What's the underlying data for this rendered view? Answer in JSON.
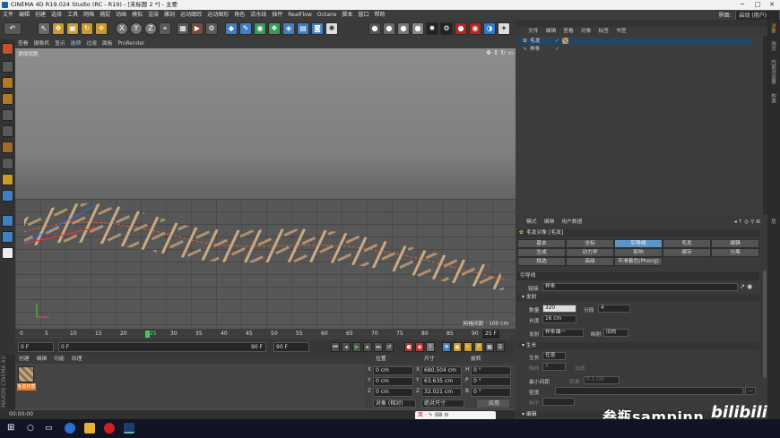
{
  "window": {
    "title": "CINEMA 4D R19.024 Studio (RC - R19) - [未标题 2 *] - 主要"
  },
  "menu": [
    "文件",
    "编辑",
    "创建",
    "选择",
    "工具",
    "网格",
    "捕捉",
    "动画",
    "模拟",
    "渲染",
    "雕刻",
    "运动跟踪",
    "运动图形",
    "角色",
    "流水线",
    "插件",
    "RealFlow",
    "Octane",
    "脚本",
    "窗口",
    "帮助"
  ],
  "layout": {
    "label": "界面:",
    "value": "启动 (用户)"
  },
  "toolbar_icons": [
    "undo-icon",
    "select-arrow-icon",
    "move-icon",
    "scale-icon",
    "rotate-icon",
    "add-icon",
    "x-axis-icon",
    "y-axis-icon",
    "z-axis-icon",
    "coord-icon",
    "render-region-icon",
    "render-view-icon",
    "render-settings-icon",
    "cube-icon",
    "pen-icon",
    "subdivision-icon",
    "cloner-icon",
    "deformer-icon",
    "scene-icon",
    "camera-icon",
    "light-icon"
  ],
  "toolbar_axis": [
    "X",
    "Y",
    "Z"
  ],
  "viewport_menu": [
    "查看",
    "摄像机",
    "显示",
    "选项",
    "过滤",
    "面板",
    "ProRender"
  ],
  "viewport": {
    "label": "透视视图",
    "grid_info": "网格间距 : 100 cm"
  },
  "timeline": {
    "ticks": [
      "0",
      "5",
      "10",
      "15",
      "20",
      "25",
      "30",
      "35",
      "40",
      "45",
      "50",
      "55",
      "60",
      "65",
      "70",
      "75",
      "80",
      "85",
      "90"
    ],
    "current": "25",
    "end_label": "25 F"
  },
  "transport": {
    "start": "0 F",
    "field2": "0 F",
    "field3": "90 F",
    "field4": "90 F"
  },
  "materials": {
    "menu": [
      "创建",
      "编辑",
      "功能",
      "纹理"
    ],
    "thumb_name": "毛发材质"
  },
  "maxon": "MAXON CINEMA 4D",
  "coords": {
    "headers": [
      "位置",
      "尺寸",
      "旋转"
    ],
    "rows": [
      {
        "axis": "X",
        "pos": "0 cm",
        "size_axis": "X",
        "size": "680.504 cm",
        "rot_axis": "H",
        "rot": "0 °"
      },
      {
        "axis": "Y",
        "pos": "0 cm",
        "size_axis": "Y",
        "size": "63.635 cm",
        "rot_axis": "P",
        "rot": "0 °"
      },
      {
        "axis": "Z",
        "pos": "0 cm",
        "size_axis": "Z",
        "size": "32.021 cm",
        "rot_axis": "B",
        "rot": "0 °"
      }
    ],
    "mode": "对象 (相对)",
    "size_mode": "绝对尺寸",
    "apply": "应用"
  },
  "status": {
    "time": "00:00:00"
  },
  "objects": {
    "menu": [
      "文件",
      "编辑",
      "查看",
      "对象",
      "标签",
      "书签"
    ],
    "rows": [
      {
        "name": "毛发",
        "selected": true
      },
      {
        "name": "样条",
        "selected": false
      }
    ]
  },
  "side_tabs": [
    "对象",
    "场次",
    "内容浏览器",
    "构造",
    "层"
  ],
  "attributes": {
    "menu": [
      "模式",
      "编辑",
      "用户数据"
    ],
    "object_title": "毛发对象 [毛发]",
    "tabs": [
      "基本",
      "坐标",
      "引导线",
      "毛发",
      "编辑",
      "生成",
      "动力学",
      "影响",
      "缓存",
      "分离",
      "挑选",
      "高级",
      "平滑着色(Phong)"
    ],
    "active_tab": "引导线",
    "section_title": "引导线",
    "link_label": "链接",
    "link_value": "样条",
    "group_emit": "发射",
    "count_label": "数量",
    "count_value": "320",
    "segments_label": "分段",
    "segments_value": "4",
    "length_label": "长度",
    "length_value": "16 cm",
    "emit_label": "发射",
    "emit_value": "样条端一",
    "map_label": "映射",
    "map_value": "旧的",
    "group_grow": "生长",
    "grow_label": "生长",
    "grow_value": "任意",
    "axis_label": "轴向",
    "axis_value": "X",
    "normal_label": "法线",
    "min_spacing_label": "最小间距",
    "distance_label": "距离",
    "distance_value": "0.1 cm",
    "density_label": "密度",
    "seed_label": "种子",
    "group_edit": "编辑"
  },
  "ime": "英 ·",
  "watermark": "叁瓶sampinn",
  "watermark_logo": "bilibili"
}
